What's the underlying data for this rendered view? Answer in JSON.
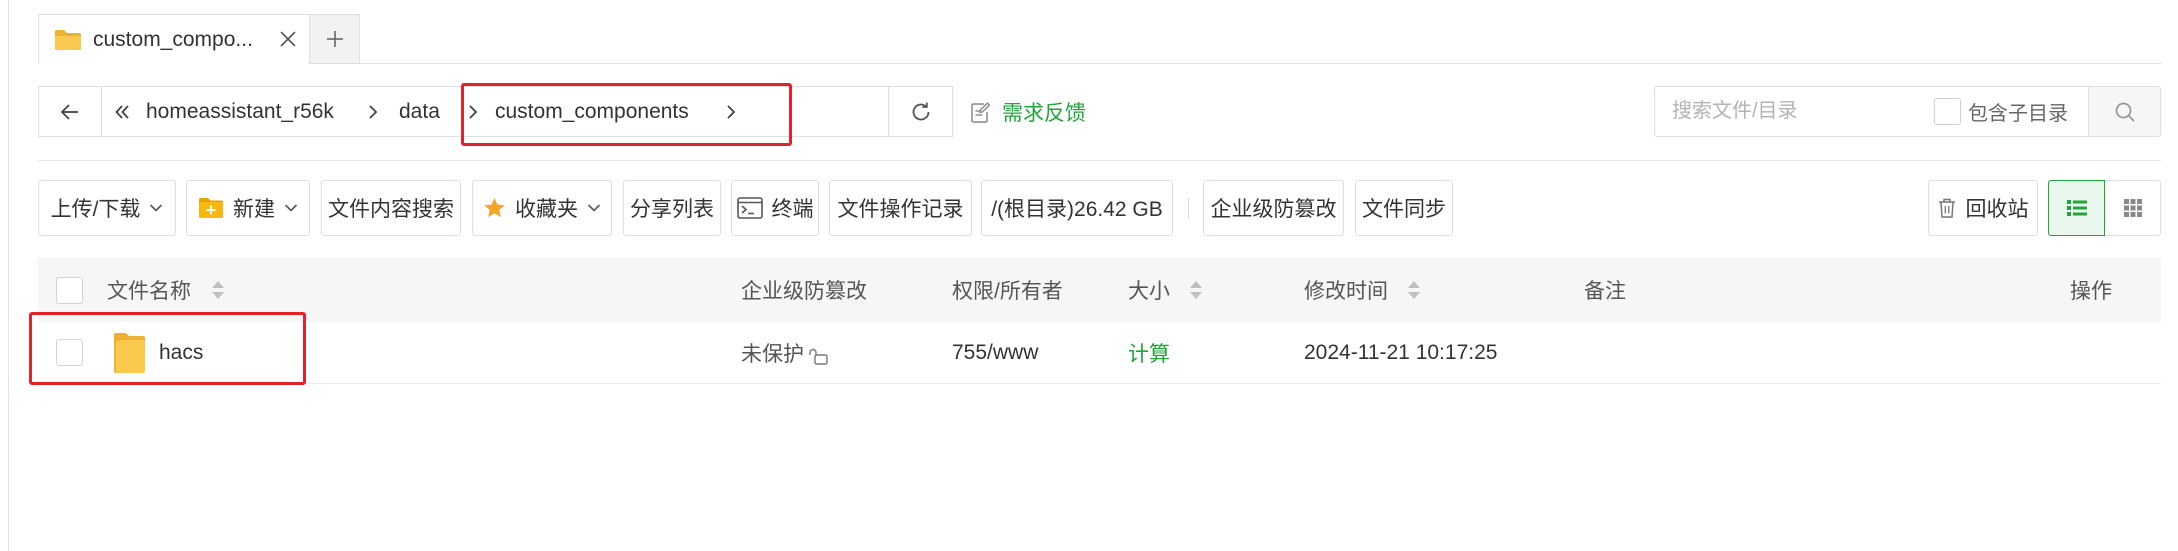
{
  "colors": {
    "accent": "#20a53a",
    "highlight": "#e3212b",
    "folder": "#f9c94e",
    "border": "#dcdfe6"
  },
  "tabs": [
    {
      "label": "custom_compo...",
      "icon": "folder-icon",
      "close_icon": "close-icon"
    }
  ],
  "new_tab_icon": "plus-icon",
  "address_bar": {
    "back_icon": "arrow-left-icon",
    "root_icon": "double-chevron-left-icon",
    "separator_icon": "chevron-right-icon",
    "breadcrumbs": [
      {
        "label": "homeassistant_r56k"
      },
      {
        "label": "data"
      },
      {
        "label": "custom_components"
      }
    ],
    "refresh_icon": "refresh-icon",
    "feedback": {
      "icon": "feedback-icon",
      "label": "需求反馈"
    }
  },
  "search": {
    "placeholder": "搜索文件/目录",
    "value": "",
    "include_subdirs_label": "包含子目录",
    "include_subdirs_checked": false,
    "icon": "search-icon"
  },
  "toolbar": {
    "buttons": [
      {
        "label": "上传/下载",
        "dropdown": true
      },
      {
        "label": "新建",
        "icon": "folder-plus-icon",
        "dropdown": true
      },
      {
        "label": "文件内容搜索"
      },
      {
        "label": "收藏夹",
        "icon": "star-icon",
        "dropdown": true
      },
      {
        "label": "分享列表"
      },
      {
        "label": "终端",
        "icon": "terminal-icon"
      },
      {
        "label": "文件操作记录"
      },
      {
        "label": "/(根目录)26.42 GB"
      },
      {
        "label": "企业级防篡改"
      },
      {
        "label": "文件同步"
      }
    ],
    "recycle_bin": {
      "label": "回收站",
      "icon": "trash-icon"
    },
    "view_mode": {
      "list_icon": "list-view-icon",
      "grid_icon": "grid-view-icon",
      "active_index": 0
    }
  },
  "table": {
    "select_all_checked": false,
    "columns": [
      {
        "label": "文件名称",
        "sortable": true
      },
      {
        "label": "企业级防篡改",
        "sortable": false
      },
      {
        "label": "权限/所有者",
        "sortable": false
      },
      {
        "label": "大小",
        "sortable": true
      },
      {
        "label": "修改时间",
        "sortable": true
      },
      {
        "label": "备注",
        "sortable": false
      },
      {
        "label": "操作",
        "sortable": false
      }
    ],
    "rows": [
      {
        "checked": false,
        "icon": "folder-icon",
        "name": "hacs",
        "tamper_protection": "未保护",
        "tamper_icon": "unlock-icon",
        "permission": "755/www",
        "size": "计算",
        "modified": "2024-11-21 10:17:25",
        "note": ""
      }
    ]
  }
}
